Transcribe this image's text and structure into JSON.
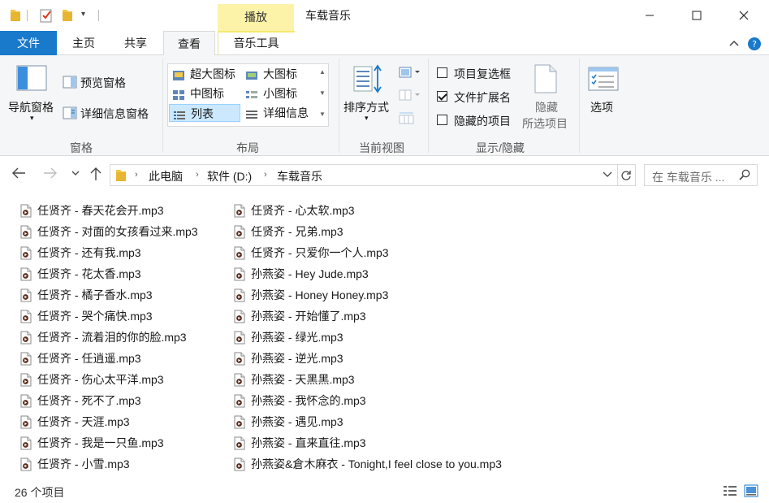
{
  "titlebar": {
    "context_tab": "播放",
    "window_title": "车载音乐"
  },
  "tabs": {
    "file": "文件",
    "home": "主页",
    "share": "共享",
    "view": "查看",
    "music_tools": "音乐工具"
  },
  "ribbon": {
    "panes": {
      "nav_pane": "导航窗格",
      "preview_pane": "预览窗格",
      "details_pane": "详细信息窗格",
      "label": "窗格"
    },
    "layout": {
      "extra_large": "超大图标",
      "large": "大图标",
      "medium": "中图标",
      "small": "小图标",
      "list": "列表",
      "details": "详细信息",
      "label": "布局"
    },
    "current_view": {
      "sort_by": "排序方式",
      "label": "当前视图"
    },
    "show_hide": {
      "item_checkboxes": "项目复选框",
      "item_checkboxes_checked": false,
      "file_extensions": "文件扩展名",
      "file_extensions_checked": true,
      "hidden_items": "隐藏的项目",
      "hidden_items_checked": false,
      "hide_selected_1": "隐藏",
      "hide_selected_2": "所选项目",
      "label": "显示/隐藏"
    },
    "options": "选项"
  },
  "address": {
    "crumbs": [
      "此电脑",
      "软件 (D:)",
      "车载音乐"
    ],
    "search_placeholder": "在 车载音乐 ..."
  },
  "files": {
    "col1": [
      "任贤齐 - 春天花会开.mp3",
      "任贤齐 - 对面的女孩看过来.mp3",
      "任贤齐 - 还有我.mp3",
      "任贤齐 - 花太香.mp3",
      "任贤齐 - 橘子香水.mp3",
      "任贤齐 - 哭个痛快.mp3",
      "任贤齐 - 流着泪的你的脸.mp3",
      "任贤齐 - 任逍遥.mp3",
      "任贤齐 - 伤心太平洋.mp3",
      "任贤齐 - 死不了.mp3",
      "任贤齐 - 天涯.mp3",
      "任贤齐 - 我是一只鱼.mp3",
      "任贤齐 - 小雪.mp3"
    ],
    "col2": [
      "任贤齐 - 心太软.mp3",
      "任贤齐 - 兄弟.mp3",
      "任贤齐 - 只爱你一个人.mp3",
      "孙燕姿 - Hey Jude.mp3",
      "孙燕姿 - Honey Honey.mp3",
      "孙燕姿 - 开始懂了.mp3",
      "孙燕姿 - 绿光.mp3",
      "孙燕姿 - 逆光.mp3",
      "孙燕姿 - 天黑黑.mp3",
      "孙燕姿 - 我怀念的.mp3",
      "孙燕姿 - 遇见.mp3",
      "孙燕姿 - 直来直往.mp3",
      "孙燕姿&倉木麻衣 - Tonight,I feel close to you.mp3"
    ]
  },
  "status": {
    "item_count": "26 个项目"
  },
  "colors": {
    "file_tab": "#1979ca",
    "context_tab": "#fcf3a8",
    "selection": "#cce8ff",
    "folder": "#f4c542"
  }
}
